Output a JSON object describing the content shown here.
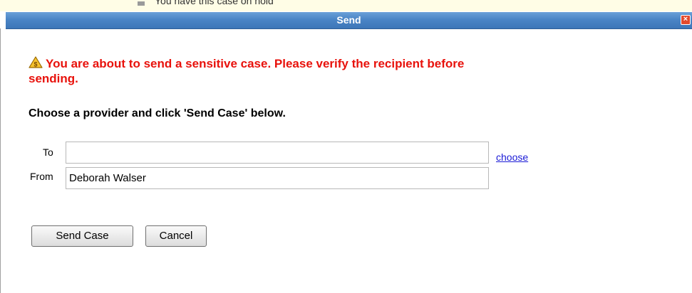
{
  "background": {
    "notice_text": "You have this case on hold"
  },
  "dialog": {
    "title": "Send",
    "close_label": "×",
    "warning_text": "You are about to send a sensitive case. Please verify the recipient before sending.",
    "instruction": "Choose a provider and click 'Send Case' below."
  },
  "form": {
    "to_label": "To",
    "to_value": "",
    "choose_link": "choose",
    "from_label": "From",
    "from_value": "Deborah Walser"
  },
  "buttons": {
    "send_label": "Send Case",
    "cancel_label": "Cancel"
  },
  "colors": {
    "title_bar": "#4a85c6",
    "warning_text": "#e8120c",
    "link": "#1a1ad6",
    "close_button": "#e24a2c"
  },
  "icons": {
    "warning": "warning-triangle-icon",
    "close": "close-icon"
  }
}
